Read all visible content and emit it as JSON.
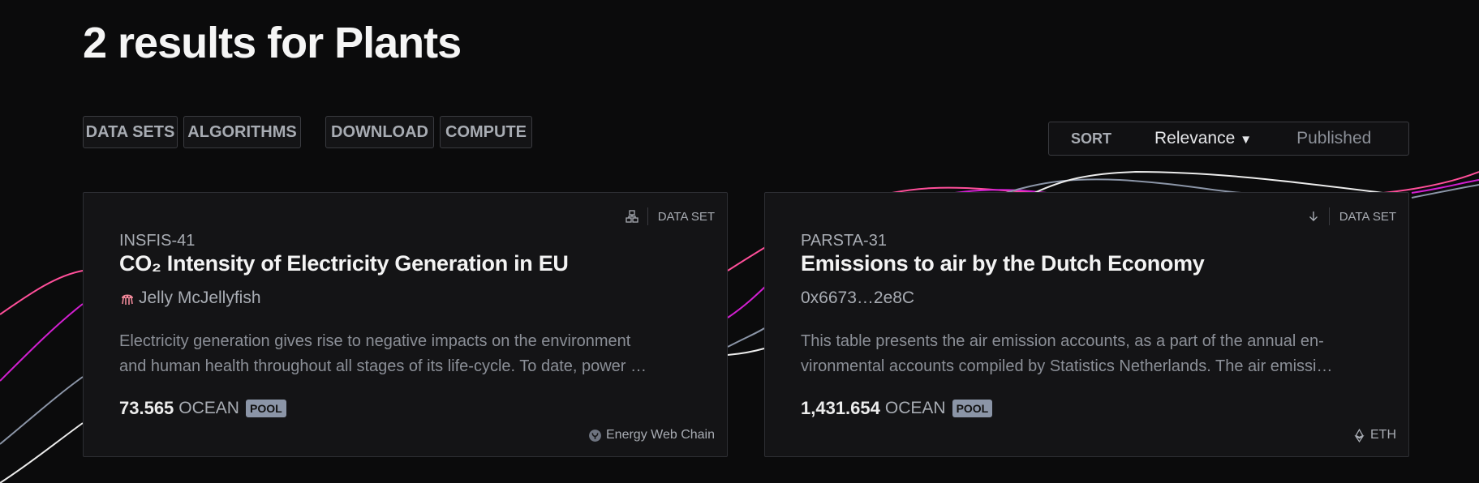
{
  "page": {
    "title": "2 results for Plants"
  },
  "filters": {
    "service_types": [
      "DATA SETS",
      "ALGORITHMS"
    ],
    "access_types": [
      "DOWNLOAD",
      "COMPUTE"
    ]
  },
  "sort": {
    "label": "SORT",
    "selected": "Relevance",
    "other": "Published"
  },
  "colors": {
    "background": "#0b0b0c",
    "card": "#141416",
    "wave_pink": "#ff4f9a",
    "wave_magenta": "#d21fd1",
    "wave_gray": "#8b95a7",
    "badge": "#8b95a7"
  },
  "results": [
    {
      "type_icon": "compute-icon",
      "type_label": "DATA SET",
      "symbol": "INSFIS-41",
      "title": "CO₂ Intensity of Electricity Generation in EU",
      "owner_icon": "jellyfish-icon",
      "owner": "Jelly McJellyfish",
      "description_lines": [
        "Electricity generation gives rise to negative impacts on the environment",
        "and human health throughout all stages of its life-cycle. To date, power …"
      ],
      "price": "73.565",
      "price_symbol": "OCEAN",
      "badge": "POOL",
      "network_icon": "energy-web-icon",
      "network": "Energy Web Chain"
    },
    {
      "type_icon": "download-icon",
      "type_label": "DATA SET",
      "symbol": "PARSTA-31",
      "title": "Emissions to air by the Dutch Economy",
      "owner": "0x6673…2e8C",
      "description_lines": [
        "This table presents the air emission accounts, as a part of the annual en-",
        "vironmental accounts compiled by Statistics Netherlands. The air emissi…"
      ],
      "price": "1,431.654",
      "price_symbol": "OCEAN",
      "badge": "POOL",
      "network_icon": "ethereum-icon",
      "network": "ETH"
    }
  ]
}
